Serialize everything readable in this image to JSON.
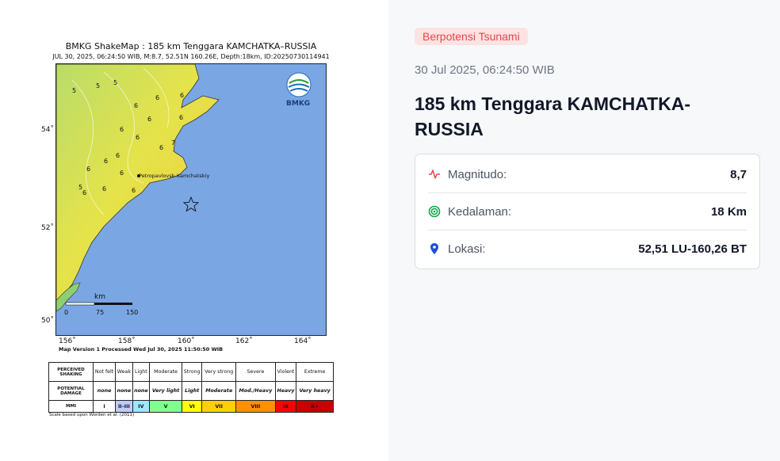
{
  "shakemap": {
    "title": "BMKG ShakeMap : 185 km Tenggara KAMCHATKA–RUSSIA",
    "subtitle": "JUL 30, 2025, 06:24:50 WIB, M:8.7, 52.51N 160.26E, Depth:18km, ID:20250730114941",
    "logo_text": "BMKG",
    "city_label": "Petropavlovsk-Kamchatskiy",
    "lat_labels": [
      "54˚",
      "52˚",
      "50˚"
    ],
    "lon_labels": [
      "156˚",
      "158˚",
      "160˚",
      "162˚",
      "164˚"
    ],
    "scale_label": "km",
    "scale_ticks": [
      "0",
      "75",
      "150"
    ],
    "intensity_marks": [
      "5",
      "5",
      "5",
      "6",
      "6",
      "6",
      "6",
      "6",
      "6",
      "6",
      "6",
      "6",
      "6",
      "6",
      "6",
      "5",
      "6",
      "7",
      "6",
      "6"
    ],
    "version_note": "Map Version 1 Processed Wed Jul 30, 2025 11:50:50 WIB",
    "scale_note": "Scale based upon Worden et al. (2011)",
    "legend": {
      "row1_header": "PERCEIVED SHAKING",
      "row2_header": "POTENTIAL DAMAGE",
      "row3_header": "MMI",
      "shaking": [
        "Not felt",
        "Weak",
        "Light",
        "Moderate",
        "Strong",
        "Very strong",
        "Severe",
        "Violent",
        "Extreme"
      ],
      "damage": [
        "none",
        "none",
        "none",
        "Very light",
        "Light",
        "Moderate",
        "Mod./Heavy",
        "Heavy",
        "Very heavy"
      ],
      "mmi": [
        "I",
        "II–III",
        "IV",
        "V",
        "VI",
        "VII",
        "VIII",
        "IX",
        "X+"
      ],
      "mmi_colors": [
        "#ffffff",
        "#bfccff",
        "#a0e6ff",
        "#80ff90",
        "#ffff00",
        "#ffd000",
        "#ff9000",
        "#ff0000",
        "#c80000"
      ]
    }
  },
  "info": {
    "badge": "Berpotensi Tsunami",
    "datetime": "30 Jul 2025, 06:24:50 WIB",
    "title": "185 km Tenggara KAMCHATKA-RUSSIA",
    "rows": [
      {
        "icon": "activity-icon",
        "label": "Magnitudo:",
        "value": "8,7",
        "color": "#e24848"
      },
      {
        "icon": "target-icon",
        "label": "Kedalaman:",
        "value": "18 Km",
        "color": "#16a34a"
      },
      {
        "icon": "map-pin-icon",
        "label": "Lokasi:",
        "value": "52,51 LU-160,26 BT",
        "color": "#1d4ed8"
      }
    ]
  }
}
